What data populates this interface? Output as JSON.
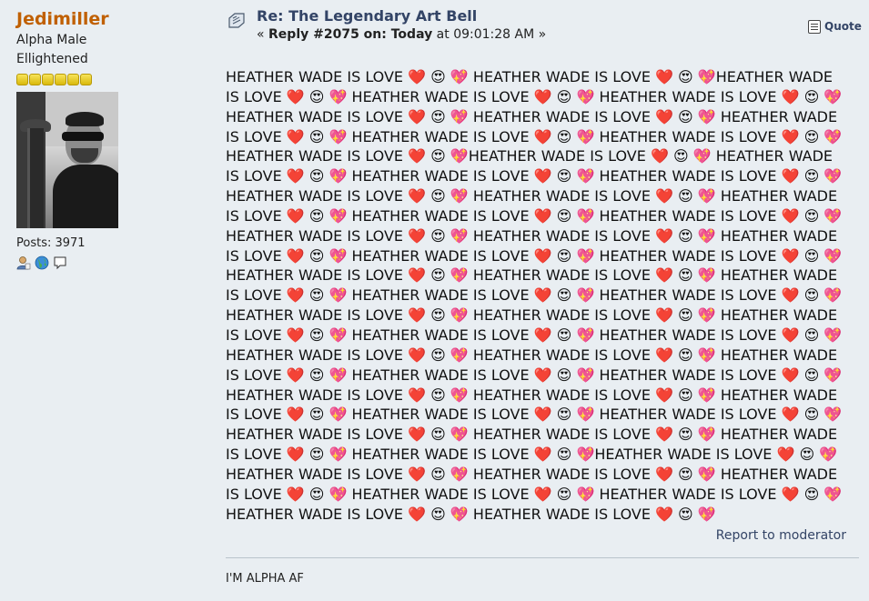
{
  "poster": {
    "name": "Jedimiller",
    "title": "Alpha Male",
    "group": "Ellightened",
    "stars": 6,
    "posts_label": "Posts: 3971"
  },
  "post": {
    "subject": "Re: The Legendary Art Bell",
    "reply_prefix": "« ",
    "reply_label": "Reply #2075 on: Today",
    "reply_time": " at 09:01:28 AM »",
    "quote_label": "Quote",
    "body": "HEATHER WADE IS LOVE ❤️ 😍 💖 HEATHER WADE IS LOVE ❤️ 😍 💖HEATHER WADE IS LOVE ❤️ 😍 💖 HEATHER WADE IS LOVE ❤️ 😍 💖 HEATHER WADE IS LOVE ❤️ 😍 💖 HEATHER WADE IS LOVE ❤️ 😍 💖 HEATHER WADE IS LOVE ❤️ 😍 💖 HEATHER WADE IS LOVE ❤️ 😍 💖 HEATHER WADE IS LOVE ❤️ 😍 💖 HEATHER WADE IS LOVE ❤️ 😍 💖 HEATHER WADE IS LOVE ❤️ 😍 💖HEATHER WADE IS LOVE ❤️ 😍 💖 HEATHER WADE IS LOVE ❤️ 😍 💖 HEATHER WADE IS LOVE ❤️ 😍 💖 HEATHER WADE IS LOVE ❤️ 😍 💖 HEATHER WADE IS LOVE ❤️ 😍 💖 HEATHER WADE IS LOVE ❤️ 😍 💖 HEATHER WADE IS LOVE ❤️ 😍 💖 HEATHER WADE IS LOVE ❤️ 😍 💖 HEATHER WADE IS LOVE ❤️ 😍 💖HEATHER WADE IS LOVE ❤️ 😍 💖 HEATHER WADE IS LOVE ❤️ 😍 💖 HEATHER WADE IS LOVE ❤️ 😍 💖 HEATHER WADE IS LOVE ❤️ 😍 💖 HEATHER WADE IS LOVE ❤️ 😍 💖 HEATHER WADE IS LOVE ❤️ 😍 💖 HEATHER WADE IS LOVE ❤️ 😍 💖 HEATHER WADE IS LOVE ❤️ 😍 💖 HEATHER WADE IS LOVE ❤️ 😍 💖 HEATHER WADE IS LOVE ❤️ 😍 💖HEATHER WADE IS LOVE ❤️ 😍 💖 HEATHER WADE IS LOVE ❤️ 😍 💖 HEATHER WADE IS LOVE ❤️ 😍 💖 HEATHER WADE IS LOVE ❤️ 😍 💖 HEATHER WADE IS LOVE ❤️ 😍 💖 HEATHER WADE IS LOVE ❤️ 😍 💖 HEATHER WADE IS LOVE ❤️ 😍 💖 HEATHER WADE IS LOVE ❤️ 😍 💖 HEATHER WADE IS LOVE ❤️ 😍 💖 HEATHER WADE IS LOVE ❤️ 😍 💖HEATHER WADE IS LOVE ❤️ 😍 💖 HEATHER WADE IS LOVE ❤️ 😍 💖 HEATHER WADE IS LOVE ❤️ 😍 💖 HEATHER WADE IS LOVE ❤️ 😍 💖 HEATHER WADE IS LOVE ❤️ 😍 💖 HEATHER WADE IS LOVE ❤️ 😍 💖 HEATHER WADE IS LOVE ❤️ 😍 💖 HEATHER WADE IS LOVE ❤️ 😍 💖 HEATHER WADE IS LOVE ❤️ 😍 💖HEATHER WADE IS LOVE ❤️ 😍 💖 HEATHER WADE IS LOVE ❤️ 😍 💖 HEATHER WADE IS LOVE ❤️ 😍 💖 HEATHER WADE IS LOVE ❤️ 😍 💖 HEATHER WADE IS LOVE ❤️ 😍 💖 HEATHER WADE IS LOVE ❤️ 😍 💖 HEATHER WADE IS LOVE ❤️ 😍 💖 HEATHER WADE IS LOVE ❤️ 😍 💖",
    "report_label": "Report to moderator",
    "signature": "I'M ALPHA AF"
  },
  "colors": {
    "background": "#e9eef2",
    "poster_name": "#c06002",
    "link": "#334466"
  }
}
